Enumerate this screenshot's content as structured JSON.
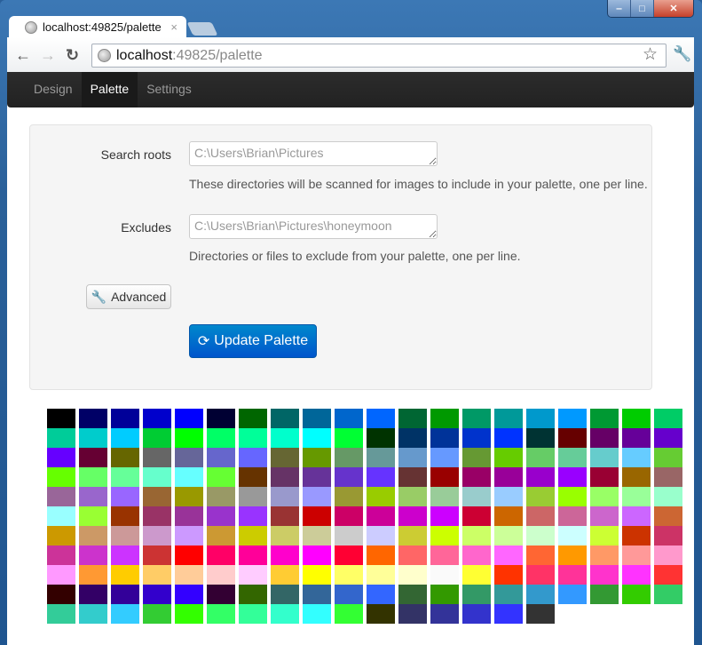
{
  "browser": {
    "tab_title": "localhost:49825/palette",
    "url_host": "localhost",
    "url_rest": ":49825/palette",
    "close_glyph": "×"
  },
  "nav": {
    "items": [
      {
        "label": "Design",
        "active": false
      },
      {
        "label": "Palette",
        "active": true
      },
      {
        "label": "Settings",
        "active": false
      }
    ]
  },
  "form": {
    "search_roots_label": "Search roots",
    "search_roots_placeholder": "C:\\Users\\Brian\\Pictures",
    "search_roots_help": "These directories will be scanned for images to include in your palette, one per line.",
    "excludes_label": "Excludes",
    "excludes_placeholder": "C:\\Users\\Brian\\Pictures\\honeymoon",
    "excludes_help": "Directories or files to exclude from your palette, one per line.",
    "advanced_label": "Advanced",
    "update_label": "Update Palette"
  },
  "palette": [
    "#000000",
    "#000066",
    "#000099",
    "#0000cc",
    "#0000ff",
    "#000033",
    "#006600",
    "#006666",
    "#006699",
    "#0066cc",
    "#0066ff",
    "#006633",
    "#009900",
    "#009966",
    "#009999",
    "#0099cc",
    "#0099ff",
    "#009933",
    "#00cc00",
    "#00cc66",
    "#00cc99",
    "#00cccc",
    "#00ccff",
    "#00cc33",
    "#00ff00",
    "#00ff66",
    "#00ff99",
    "#00ffcc",
    "#00ffff",
    "#00ff33",
    "#003300",
    "#003366",
    "#003399",
    "#0033cc",
    "#0033ff",
    "#003333",
    "#660000",
    "#660066",
    "#660099",
    "#6600cc",
    "#6600ff",
    "#660033",
    "#666600",
    "#666666",
    "#666699",
    "#6666cc",
    "#6666ff",
    "#666633",
    "#669900",
    "#669966",
    "#669999",
    "#6699cc",
    "#6699ff",
    "#669933",
    "#66cc00",
    "#66cc66",
    "#66cc99",
    "#66cccc",
    "#66ccff",
    "#66cc33",
    "#66ff00",
    "#66ff66",
    "#66ff99",
    "#66ffcc",
    "#66ffff",
    "#66ff33",
    "#663300",
    "#663366",
    "#663399",
    "#6633cc",
    "#6633ff",
    "#663333",
    "#990000",
    "#990066",
    "#990099",
    "#9900cc",
    "#9900ff",
    "#990033",
    "#996600",
    "#996666",
    "#996699",
    "#9966cc",
    "#9966ff",
    "#996633",
    "#999900",
    "#999966",
    "#999999",
    "#9999cc",
    "#9999ff",
    "#999933",
    "#99cc00",
    "#99cc66",
    "#99cc99",
    "#99cccc",
    "#99ccff",
    "#99cc33",
    "#99ff00",
    "#99ff66",
    "#99ff99",
    "#99ffcc",
    "#99ffff",
    "#99ff33",
    "#993300",
    "#993366",
    "#993399",
    "#9933cc",
    "#9933ff",
    "#993333",
    "#cc0000",
    "#cc0066",
    "#cc0099",
    "#cc00cc",
    "#cc00ff",
    "#cc0033",
    "#cc6600",
    "#cc6666",
    "#cc6699",
    "#cc66cc",
    "#cc66ff",
    "#cc6633",
    "#cc9900",
    "#cc9966",
    "#cc9999",
    "#cc99cc",
    "#cc99ff",
    "#cc9933",
    "#cccc00",
    "#cccc66",
    "#cccc99",
    "#cccccc",
    "#ccccff",
    "#cccc33",
    "#ccff00",
    "#ccff66",
    "#ccff99",
    "#ccffcc",
    "#ccffff",
    "#ccff33",
    "#cc3300",
    "#cc3366",
    "#cc3399",
    "#cc33cc",
    "#cc33ff",
    "#cc3333",
    "#ff0000",
    "#ff0066",
    "#ff0099",
    "#ff00cc",
    "#ff00ff",
    "#ff0033",
    "#ff6600",
    "#ff6666",
    "#ff6699",
    "#ff66cc",
    "#ff66ff",
    "#ff6633",
    "#ff9900",
    "#ff9966",
    "#ff9999",
    "#ff99cc",
    "#ff99ff",
    "#ff9933",
    "#ffcc00",
    "#ffcc66",
    "#ffcc99",
    "#ffcccc",
    "#ffccff",
    "#ffcc33",
    "#ffff00",
    "#ffff66",
    "#ffff99",
    "#ffffcc",
    "#fafafa",
    "#ffff33",
    "#ff3300",
    "#ff3366",
    "#ff3399",
    "#ff33cc",
    "#ff33ff",
    "#ff3333",
    "#330000",
    "#330066",
    "#330099",
    "#3300cc",
    "#3300ff",
    "#330033",
    "#336600",
    "#336666",
    "#336699",
    "#3366cc",
    "#3366ff",
    "#336633",
    "#339900",
    "#339966",
    "#339999",
    "#3399cc",
    "#3399ff",
    "#339933",
    "#33cc00",
    "#33cc66",
    "#33cc99",
    "#33cccc",
    "#33ccff",
    "#33cc33",
    "#33ff00",
    "#33ff66",
    "#33ff99",
    "#33ffcc",
    "#33ffff",
    "#33ff33",
    "#333300",
    "#333366",
    "#333399",
    "#3333cc",
    "#3333ff",
    "#333333"
  ]
}
